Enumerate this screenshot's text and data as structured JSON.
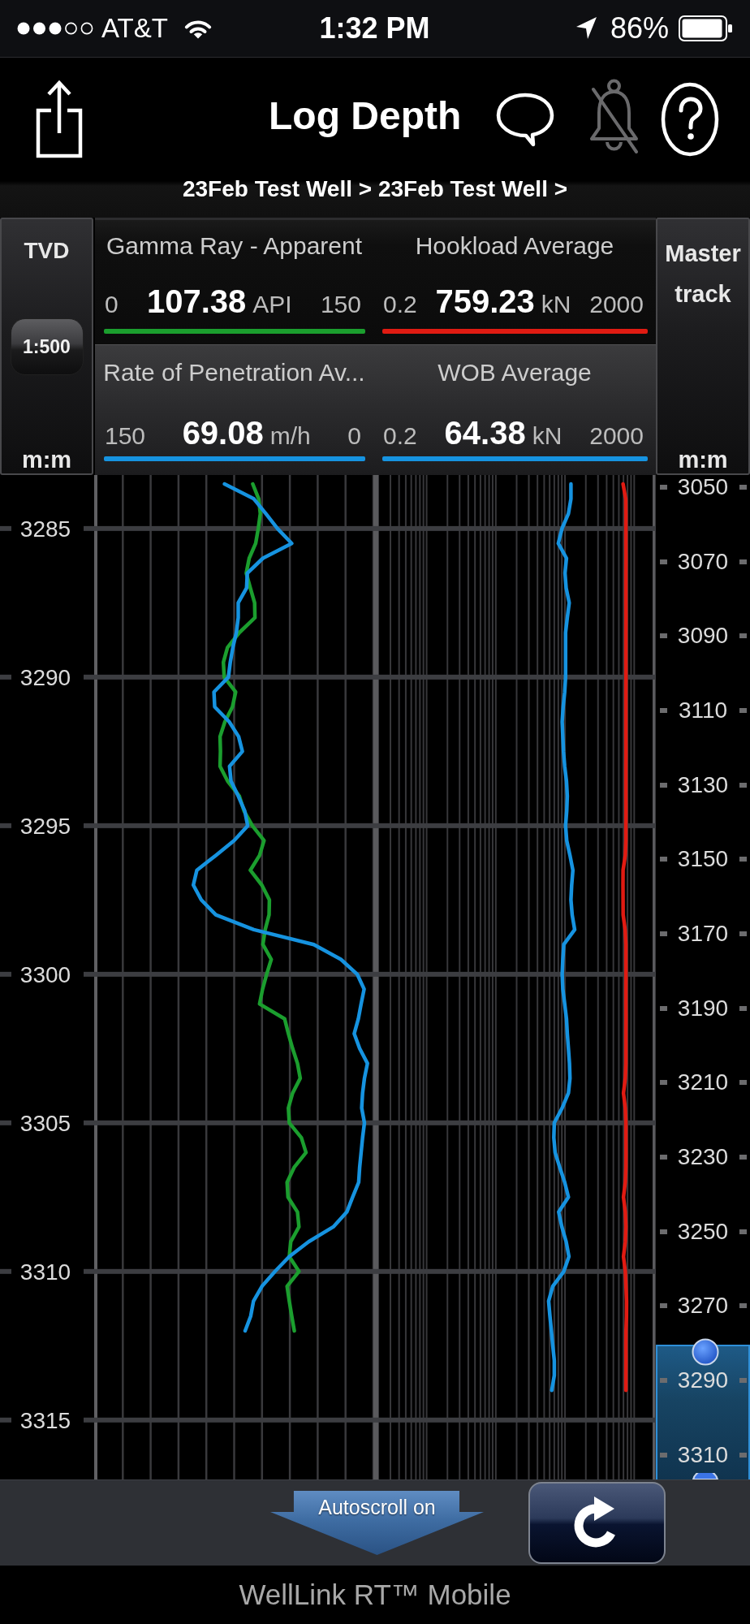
{
  "status_bar": {
    "carrier": "AT&T",
    "time": "1:32 PM",
    "battery": "86%"
  },
  "nav_bar": {
    "title": "Log Depth",
    "alarm_muted": true
  },
  "breadcrumb": "23Feb Test Well > 23Feb Test Well >",
  "depth_panel": {
    "label": "TVD",
    "scale": "1:500",
    "unit": "m:m"
  },
  "curve_header_rows": [
    [
      {
        "title": "Gamma Ray - Apparent",
        "min": "0",
        "value": "107.38",
        "unit": "API",
        "max": "150",
        "color": "#1b9e2e"
      },
      {
        "title": "Hookload Average",
        "min": "0.2",
        "value": "759.23",
        "unit": "kN",
        "max": "2000",
        "color": "#e01b12"
      }
    ],
    [
      {
        "title": "Rate of Penetration Av...",
        "min": "150",
        "value": "69.08",
        "unit": "m/h",
        "max": "0",
        "color": "#1693e0"
      },
      {
        "title": "WOB Average",
        "min": "0.2",
        "value": "64.38",
        "unit": "kN",
        "max": "2000",
        "color": "#1693e0"
      }
    ]
  ],
  "master_track": {
    "label": "Master track",
    "unit": "m:m",
    "ticks": [
      "3050",
      "3070",
      "3090",
      "3110",
      "3130",
      "3150",
      "3170",
      "3190",
      "3210",
      "3230",
      "3250",
      "3270",
      "3290",
      "3310"
    ]
  },
  "depth_axis": {
    "ticks": [
      "3285",
      "3290",
      "3295",
      "3300",
      "3305",
      "3310",
      "3315"
    ]
  },
  "bottom_bar": {
    "autoscroll": {
      "label": "Autoscroll on",
      "on": true
    }
  },
  "footer": "WellLink RT™ Mobile"
}
